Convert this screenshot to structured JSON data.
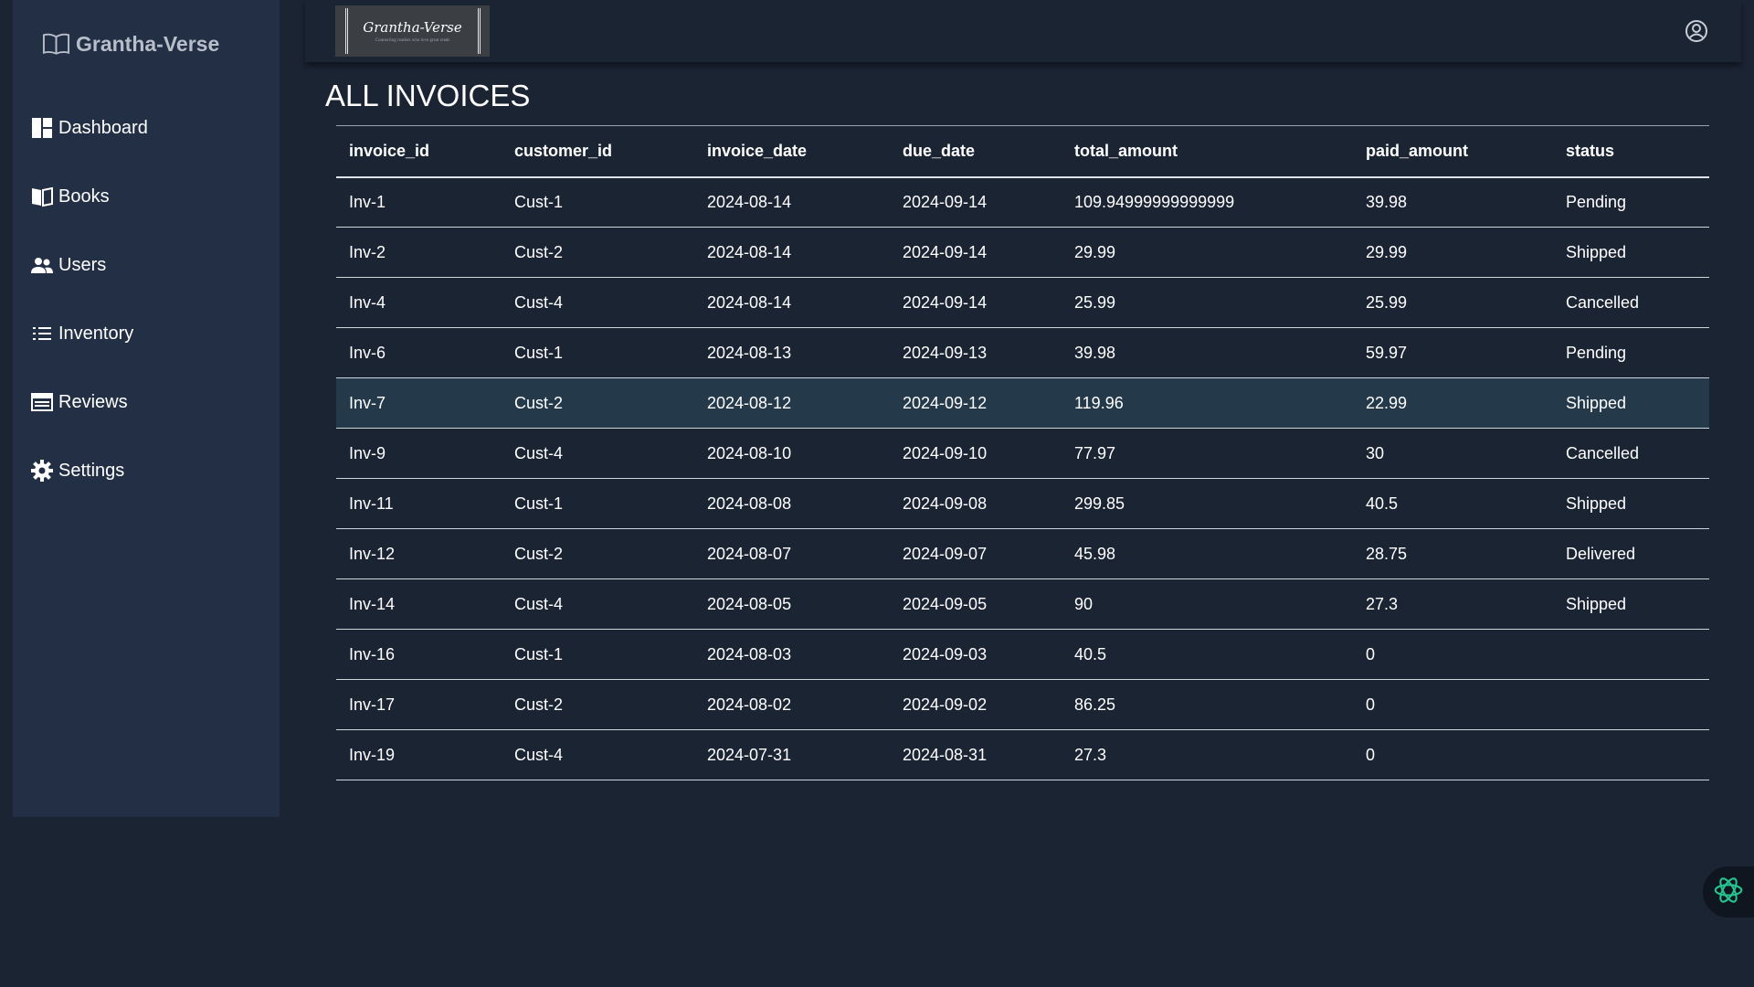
{
  "brand": {
    "name": "Grantha-Verse"
  },
  "sidebar": {
    "items": [
      {
        "label": "Dashboard",
        "icon": "dashboard-icon"
      },
      {
        "label": "Books",
        "icon": "book-icon"
      },
      {
        "label": "Users",
        "icon": "users-icon"
      },
      {
        "label": "Inventory",
        "icon": "list-icon"
      },
      {
        "label": "Reviews",
        "icon": "reviews-icon"
      },
      {
        "label": "Settings",
        "icon": "gear-icon"
      }
    ]
  },
  "header": {
    "logo_title": "Grantha-Verse",
    "logo_tagline": "Connecting readers who love great reads",
    "user_icon": "user-circle-icon"
  },
  "page": {
    "title": "ALL INVOICES"
  },
  "table": {
    "columns": [
      "invoice_id",
      "customer_id",
      "invoice_date",
      "due_date",
      "total_amount",
      "paid_amount",
      "status"
    ],
    "rows": [
      {
        "invoice_id": "Inv-1",
        "customer_id": "Cust-1",
        "invoice_date": "2024-08-14",
        "due_date": "2024-09-14",
        "total_amount": "109.94999999999999",
        "paid_amount": "39.98",
        "status": "Pending"
      },
      {
        "invoice_id": "Inv-2",
        "customer_id": "Cust-2",
        "invoice_date": "2024-08-14",
        "due_date": "2024-09-14",
        "total_amount": "29.99",
        "paid_amount": "29.99",
        "status": "Shipped"
      },
      {
        "invoice_id": "Inv-4",
        "customer_id": "Cust-4",
        "invoice_date": "2024-08-14",
        "due_date": "2024-09-14",
        "total_amount": "25.99",
        "paid_amount": "25.99",
        "status": "Cancelled"
      },
      {
        "invoice_id": "Inv-6",
        "customer_id": "Cust-1",
        "invoice_date": "2024-08-13",
        "due_date": "2024-09-13",
        "total_amount": "39.98",
        "paid_amount": "59.97",
        "status": "Pending"
      },
      {
        "invoice_id": "Inv-7",
        "customer_id": "Cust-2",
        "invoice_date": "2024-08-12",
        "due_date": "2024-09-12",
        "total_amount": "119.96",
        "paid_amount": "22.99",
        "status": "Shipped"
      },
      {
        "invoice_id": "Inv-9",
        "customer_id": "Cust-4",
        "invoice_date": "2024-08-10",
        "due_date": "2024-09-10",
        "total_amount": "77.97",
        "paid_amount": "30",
        "status": "Cancelled"
      },
      {
        "invoice_id": "Inv-11",
        "customer_id": "Cust-1",
        "invoice_date": "2024-08-08",
        "due_date": "2024-09-08",
        "total_amount": "299.85",
        "paid_amount": "40.5",
        "status": "Shipped"
      },
      {
        "invoice_id": "Inv-12",
        "customer_id": "Cust-2",
        "invoice_date": "2024-08-07",
        "due_date": "2024-09-07",
        "total_amount": "45.98",
        "paid_amount": "28.75",
        "status": "Delivered"
      },
      {
        "invoice_id": "Inv-14",
        "customer_id": "Cust-4",
        "invoice_date": "2024-08-05",
        "due_date": "2024-09-05",
        "total_amount": "90",
        "paid_amount": "27.3",
        "status": "Shipped"
      },
      {
        "invoice_id": "Inv-16",
        "customer_id": "Cust-1",
        "invoice_date": "2024-08-03",
        "due_date": "2024-09-03",
        "total_amount": "40.5",
        "paid_amount": "0",
        "status": ""
      },
      {
        "invoice_id": "Inv-17",
        "customer_id": "Cust-2",
        "invoice_date": "2024-08-02",
        "due_date": "2024-09-02",
        "total_amount": "86.25",
        "paid_amount": "0",
        "status": ""
      },
      {
        "invoice_id": "Inv-19",
        "customer_id": "Cust-4",
        "invoice_date": "2024-07-31",
        "due_date": "2024-08-31",
        "total_amount": "27.3",
        "paid_amount": "0",
        "status": ""
      }
    ],
    "highlighted_row": "Inv-7"
  },
  "fab": {
    "icon": "ai-assistant-icon"
  },
  "colors": {
    "background": "#1b2433",
    "sidebar": "#222f44",
    "highlight_row": "#24394a",
    "accent": "#27c48f"
  }
}
